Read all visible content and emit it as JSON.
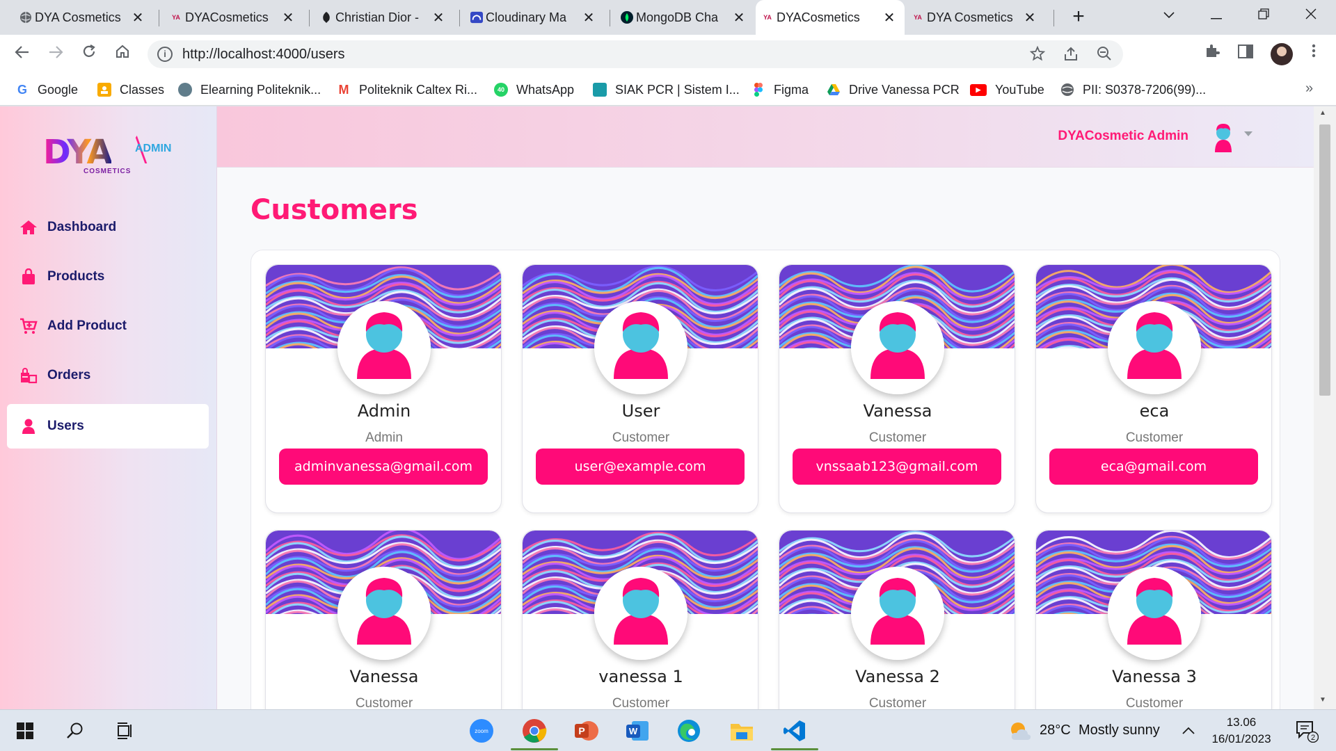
{
  "browser": {
    "tabs": [
      {
        "label": "DYA Cosmetics",
        "favicon": "globe-icon",
        "active": false
      },
      {
        "label": "DYACosmetics",
        "favicon": "dya-favicon",
        "active": false
      },
      {
        "label": "Christian Dior -",
        "favicon": "dior-favicon",
        "active": false
      },
      {
        "label": "Cloudinary Ma",
        "favicon": "cloudinary-favicon",
        "active": false
      },
      {
        "label": "MongoDB Cha",
        "favicon": "mongodb-favicon",
        "active": false
      },
      {
        "label": "DYACosmetics",
        "favicon": "dya-favicon",
        "active": true
      },
      {
        "label": "DYA Cosmetics",
        "favicon": "dya-favicon",
        "active": false
      }
    ],
    "favicon_text": "YA",
    "url": "http://localhost:4000/users"
  },
  "bookmarks": [
    {
      "label": "Google",
      "icon": "google-icon",
      "color": "#4285f4",
      "glyph": "G"
    },
    {
      "label": "Classes",
      "icon": "classroom-icon",
      "color": "#f9ab00",
      "glyph": ""
    },
    {
      "label": "Elearning Politeknik...",
      "icon": "elearning-icon",
      "color": "#607d8b",
      "glyph": ""
    },
    {
      "label": "Politeknik Caltex Ri...",
      "icon": "gmail-icon",
      "color": "#ea4335",
      "glyph": "M"
    },
    {
      "label": "WhatsApp",
      "icon": "whatsapp-icon",
      "color": "#25d366",
      "glyph": "40"
    },
    {
      "label": "SIAK PCR | Sistem I...",
      "icon": "siak-icon",
      "color": "#1a9ba8",
      "glyph": ""
    },
    {
      "label": "Figma",
      "icon": "figma-icon",
      "color": "#f24e1e",
      "glyph": ""
    },
    {
      "label": "Drive Vanessa PCR",
      "icon": "drive-icon",
      "color": "#0f9d58",
      "glyph": ""
    },
    {
      "label": "YouTube",
      "icon": "youtube-icon",
      "color": "#ff0000",
      "glyph": "▶"
    },
    {
      "label": "PII: S0378-7206(99)...",
      "icon": "globe-icon",
      "color": "#5f6368",
      "glyph": ""
    }
  ],
  "app": {
    "logo": {
      "brand": "DYA",
      "sub": "COSMETICS",
      "tag": "ADMIN"
    },
    "nav": [
      {
        "label": "Dashboard",
        "icon": "home-icon",
        "active": false
      },
      {
        "label": "Products",
        "icon": "shopping-bag-icon",
        "active": false
      },
      {
        "label": "Add Product",
        "icon": "cart-plus-icon",
        "active": false
      },
      {
        "label": "Orders",
        "icon": "orders-icon",
        "active": false
      },
      {
        "label": "Users",
        "icon": "user-icon",
        "active": true
      }
    ],
    "header": {
      "user_name": "DYACosmetic Admin"
    },
    "page_title": "Customers",
    "users": [
      {
        "name": "Admin",
        "role": "Admin",
        "email": "adminvanessa@gmail.com"
      },
      {
        "name": "User",
        "role": "Customer",
        "email": "user@example.com"
      },
      {
        "name": "Vanessa",
        "role": "Customer",
        "email": "vnssaab123@gmail.com"
      },
      {
        "name": "eca",
        "role": "Customer",
        "email": "eca@gmail.com"
      },
      {
        "name": "Vanessa",
        "role": "Customer",
        "email": ""
      },
      {
        "name": "vanessa 1",
        "role": "Customer",
        "email": ""
      },
      {
        "name": "Vanessa 2",
        "role": "Customer",
        "email": ""
      },
      {
        "name": "Vanessa 3",
        "role": "Customer",
        "email": ""
      }
    ]
  },
  "taskbar": {
    "weather_temp": "28°C",
    "weather_desc": "Mostly sunny",
    "time": "13.06",
    "date": "16/01/2023",
    "notifications": "2",
    "zoom_label": "zoom"
  },
  "colors": {
    "accent": "#ff1a75",
    "nav_text": "#1b1b6b",
    "email_button": "#ff0a78"
  }
}
